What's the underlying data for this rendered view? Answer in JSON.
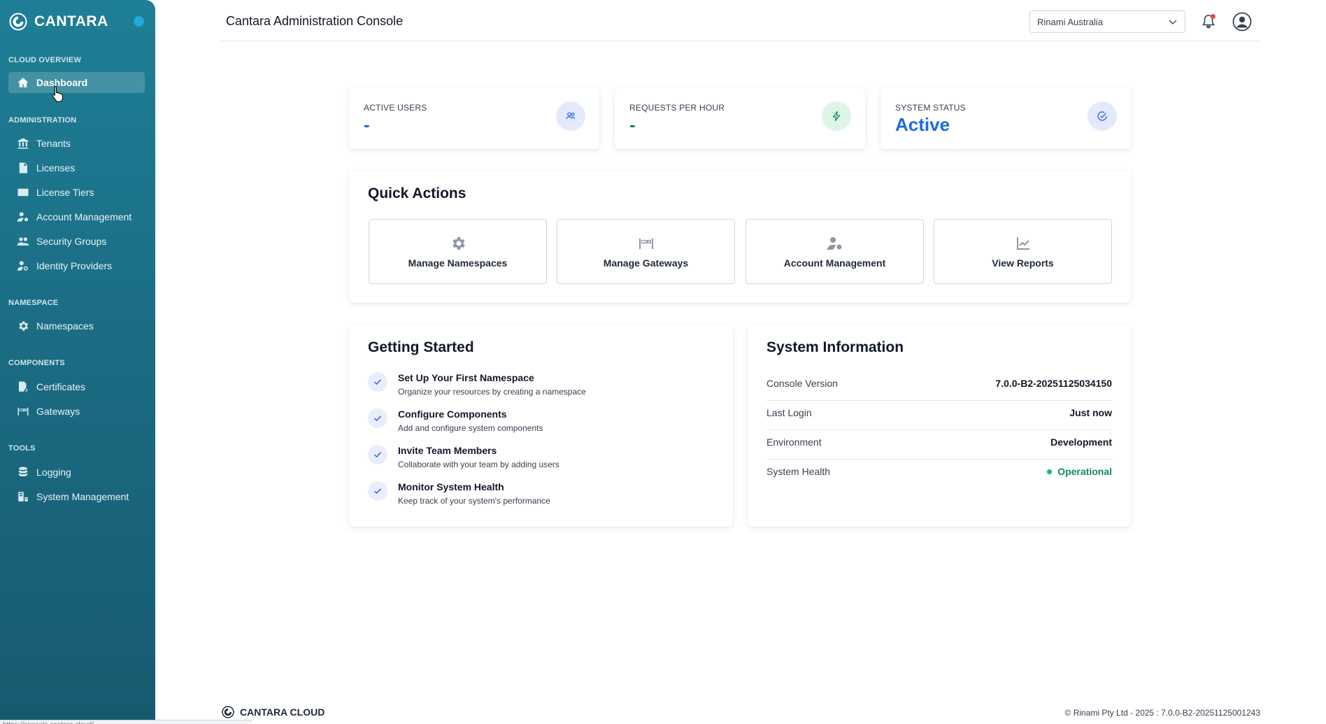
{
  "brand": {
    "name": "CANTARA"
  },
  "sidebar": {
    "sections": [
      {
        "title": "CLOUD OVERVIEW",
        "items": [
          {
            "label": "Dashboard",
            "icon": "home-icon",
            "active": true
          }
        ]
      },
      {
        "title": "ADMINISTRATION",
        "items": [
          {
            "label": "Tenants",
            "icon": "building-icon"
          },
          {
            "label": "Licenses",
            "icon": "license-file-icon"
          },
          {
            "label": "License Tiers",
            "icon": "id-card-icon"
          },
          {
            "label": "Account Management",
            "icon": "user-gear-icon"
          },
          {
            "label": "Security Groups",
            "icon": "users-icon"
          },
          {
            "label": "Identity Providers",
            "icon": "user-key-icon"
          }
        ]
      },
      {
        "title": "NAMESPACE",
        "items": [
          {
            "label": "Namespaces",
            "icon": "gear-icon"
          }
        ]
      },
      {
        "title": "COMPONENTS",
        "items": [
          {
            "label": "Certificates",
            "icon": "certificate-icon"
          },
          {
            "label": "Gateways",
            "icon": "gateway-icon"
          }
        ]
      },
      {
        "title": "TOOLS",
        "items": [
          {
            "label": "Logging",
            "icon": "database-icon"
          },
          {
            "label": "System Management",
            "icon": "server-icon"
          }
        ]
      }
    ]
  },
  "header": {
    "title": "Cantara Administration Console",
    "tenant_select": "Rinami Australia"
  },
  "stats": {
    "active_users": {
      "label": "ACTIVE USERS",
      "value": "-",
      "color": "#2563eb"
    },
    "requests": {
      "label": "REQUESTS PER HOUR",
      "value": "-",
      "color": "#0f8a5f"
    },
    "system_status": {
      "label": "SYSTEM STATUS",
      "value": "Active",
      "color": "#1d6be0"
    }
  },
  "quick_actions": {
    "title": "Quick Actions",
    "buttons": [
      {
        "label": "Manage Namespaces",
        "icon": "gear-icon"
      },
      {
        "label": "Manage Gateways",
        "icon": "gateway-icon"
      },
      {
        "label": "Account Management",
        "icon": "user-gear-icon"
      },
      {
        "label": "View Reports",
        "icon": "chart-line-icon"
      }
    ]
  },
  "getting_started": {
    "title": "Getting Started",
    "items": [
      {
        "title": "Set Up Your First Namespace",
        "desc": "Organize your resources by creating a namespace"
      },
      {
        "title": "Configure Components",
        "desc": "Add and configure system components"
      },
      {
        "title": "Invite Team Members",
        "desc": "Collaborate with your team by adding users"
      },
      {
        "title": "Monitor System Health",
        "desc": "Keep track of your system's performance"
      }
    ]
  },
  "system_info": {
    "title": "System Information",
    "rows": [
      {
        "key": "Console Version",
        "value": "7.0.0-B2-20251125034150"
      },
      {
        "key": "Last Login",
        "value": "Just now"
      },
      {
        "key": "Environment",
        "value": "Development"
      },
      {
        "key": "System Health",
        "value": "Operational"
      }
    ]
  },
  "footer": {
    "brand": "CANTARA CLOUD",
    "copyright": "© Rinami Pty Ltd - 2025 : 7.0.0-B2-20251125001243"
  },
  "status_bar": {
    "url": "https://console.cantara.cloud/..."
  }
}
